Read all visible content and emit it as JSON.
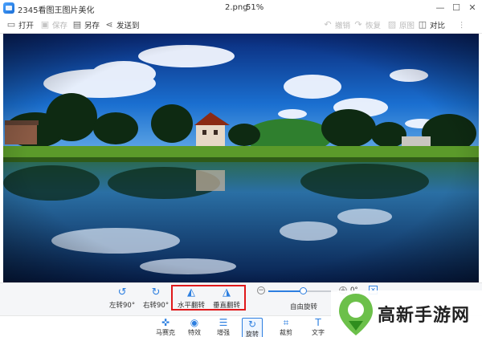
{
  "window": {
    "app_title": "2345看图王图片美化",
    "file_name": "2.png",
    "zoom": "51%"
  },
  "toolbar": {
    "open": "打开",
    "save": "保存",
    "save_as": "另存",
    "send_to": "发送到",
    "undo": "撤销",
    "redo": "恢复",
    "original": "原图",
    "compare": "对比"
  },
  "rotate_panel": {
    "rotate_left": "左转90°",
    "rotate_right": "右转90°",
    "flip_horizontal": "水平翻转",
    "flip_vertical": "垂直翻转",
    "free_rotate": "自由旋转",
    "angle": "0°",
    "angle_value": 0,
    "slider_fraction": 0.5
  },
  "nav": {
    "mosaic": "马赛克",
    "effects": "特效",
    "enhance": "增强",
    "rotate": "旋转",
    "crop": "裁剪",
    "text": "文字"
  },
  "watermark": {
    "text": "高新手游网"
  },
  "colors": {
    "accent": "#2d7fe0",
    "highlight": "#e0191b"
  },
  "icons": {
    "rotate_left": "rotate-left-icon",
    "rotate_right": "rotate-right-icon",
    "flip_horizontal": "flip-horizontal-icon",
    "flip_vertical": "flip-vertical-icon"
  }
}
